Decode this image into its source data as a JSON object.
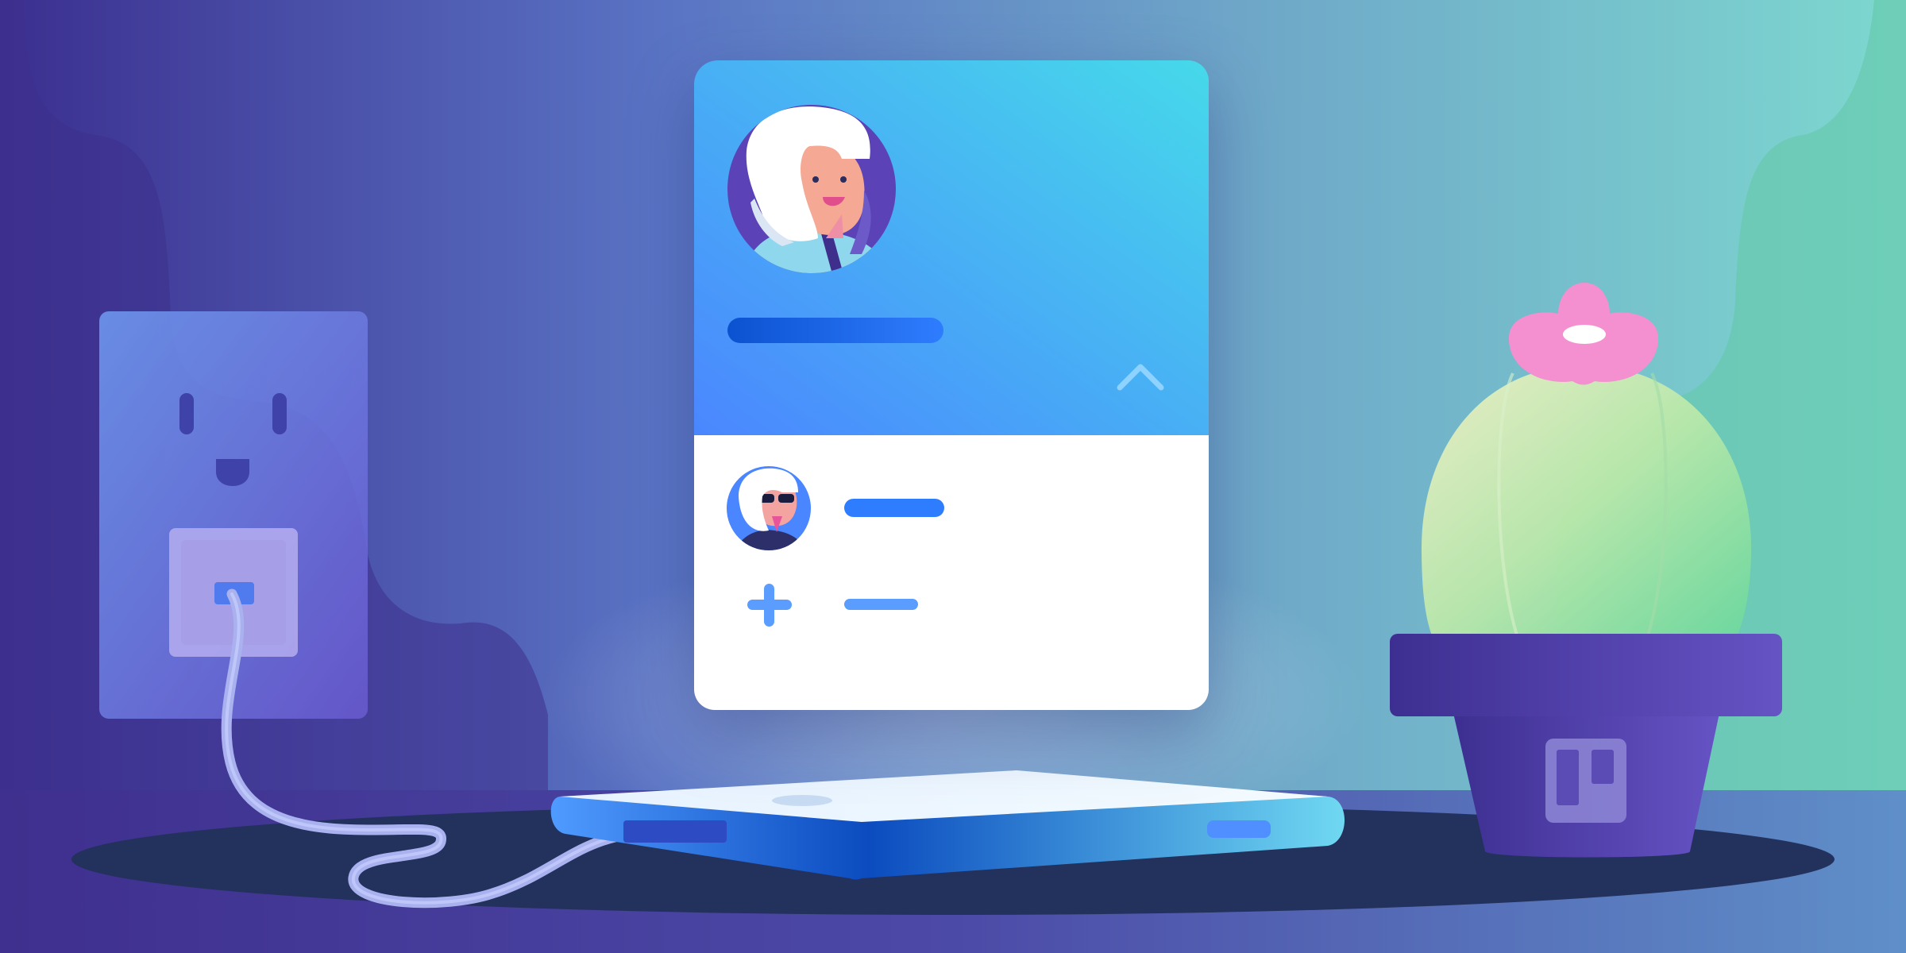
{
  "illustration": {
    "profile_card": {
      "header_icon": "chevron-up-icon",
      "rows": [
        {
          "icon": "avatar-sunglasses"
        },
        {
          "icon": "plus-icon"
        }
      ]
    },
    "pot_logo": "board-columns-icon",
    "colors": {
      "background_left": "#3b2f8f",
      "background_right": "#7dd8cf",
      "card_header_start": "#4a90ff",
      "card_header_end": "#46d7ea",
      "card_body": "#ffffff",
      "accent_blue": "#2f7dff",
      "cactus_flower": "#f490cf",
      "pot": "#4a36a8"
    }
  }
}
